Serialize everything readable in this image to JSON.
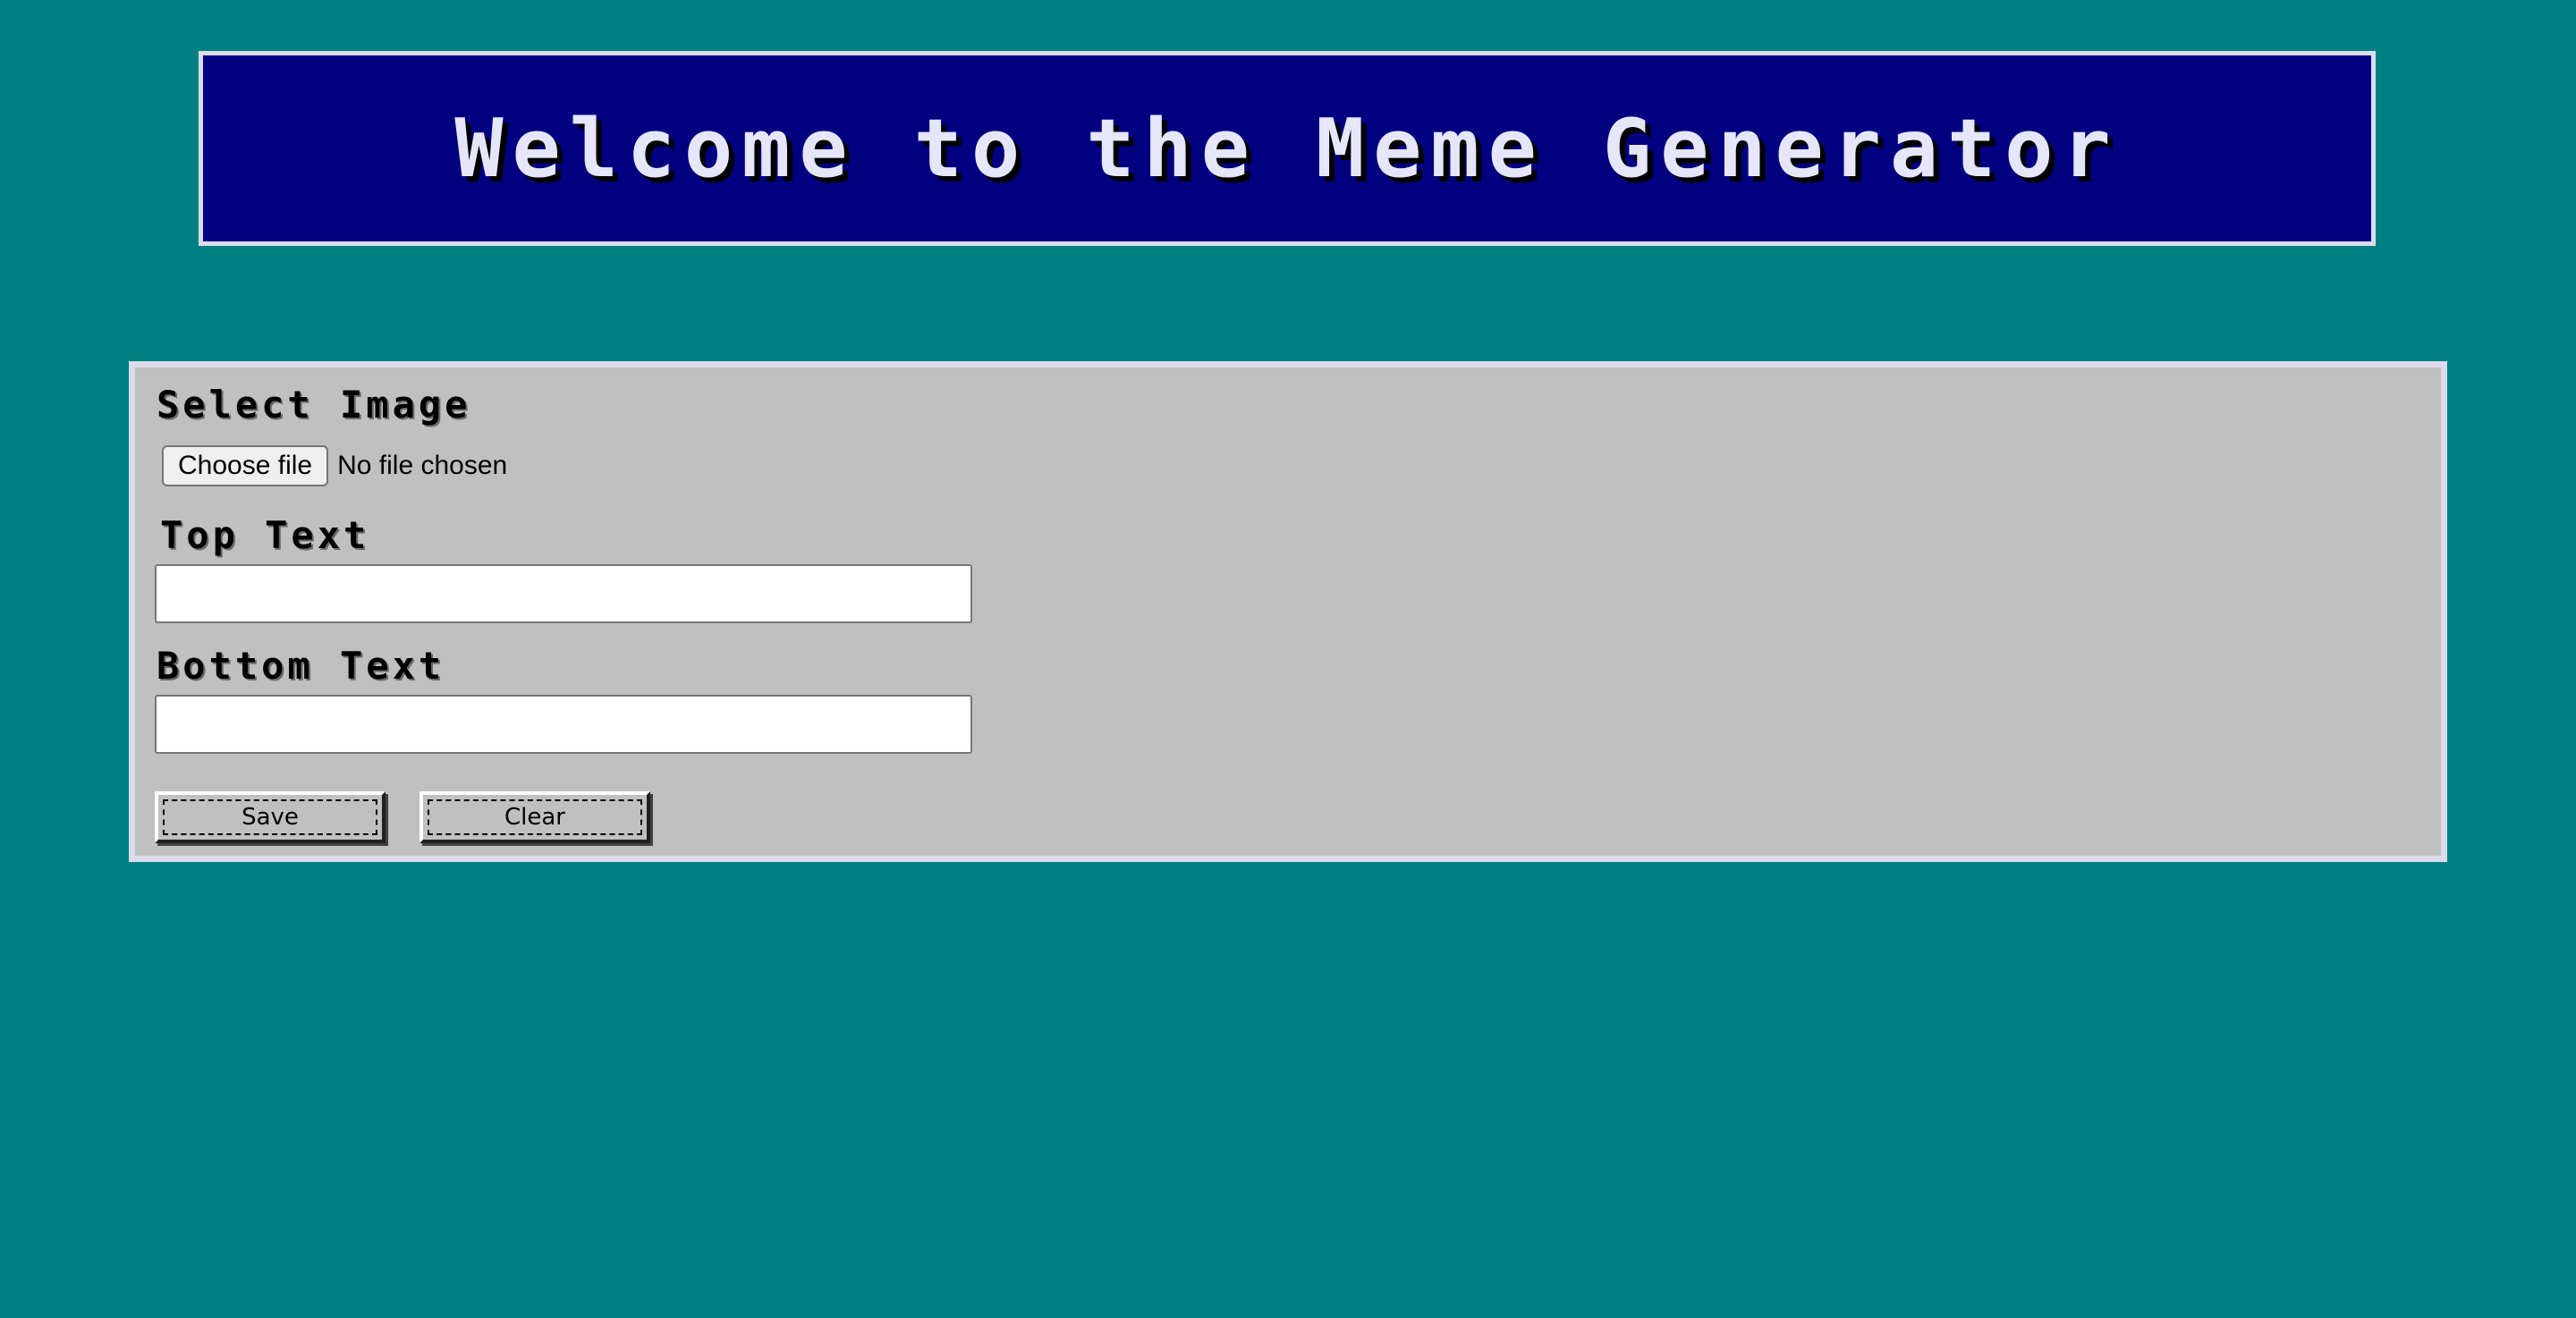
{
  "header": {
    "title": "Welcome to the Meme Generator"
  },
  "form": {
    "select_image_label": "Select Image",
    "file_button_label": "Choose file",
    "file_status": "No file chosen",
    "top_text_label": "Top Text",
    "top_text_value": "",
    "bottom_text_label": "Bottom Text",
    "bottom_text_value": "",
    "save_label": "Save",
    "clear_label": "Clear"
  },
  "colors": {
    "background": "#008080",
    "header_background": "#000080",
    "header_text": "#e6e6fa",
    "panel_background": "#c0c0c0",
    "border": "#dcdcec"
  }
}
